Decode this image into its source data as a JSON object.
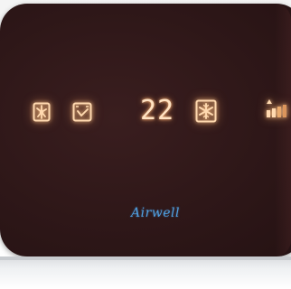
{
  "display": {
    "temperature": "22",
    "icons": {
      "mode": "fan-speed-icon",
      "timer": "timer-clock-icon",
      "cooling": "snowflake-cool-icon",
      "signal": "signal-strength-icon"
    },
    "glow_color": "#ffcf9e"
  },
  "brand": {
    "name": "Airwell",
    "color": "#4f9fe0"
  },
  "panel": {
    "color": "#2e1718"
  }
}
